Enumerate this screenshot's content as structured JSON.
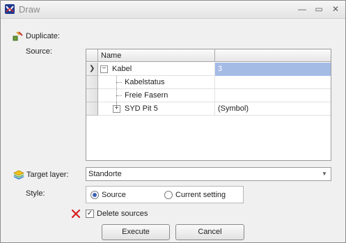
{
  "window": {
    "title": "Draw",
    "minimize": "—",
    "maximize": "▭",
    "close": "✕"
  },
  "duplicate": {
    "label": "Duplicate:"
  },
  "source": {
    "label": "Source:",
    "columns": [
      "Name",
      ""
    ],
    "rows": [
      {
        "name": "Kabel",
        "value": "3",
        "expander": "−"
      },
      {
        "name": "Kabelstatus",
        "value": ""
      },
      {
        "name": "Freie Fasern",
        "value": ""
      },
      {
        "name": "SYD Pit 5",
        "value": "(Symbol)",
        "expander": "+"
      }
    ],
    "current_row_marker": "❯"
  },
  "target_layer": {
    "label": "Target layer:",
    "value": "Standorte"
  },
  "style": {
    "label": "Style:",
    "options": [
      "Source",
      "Current setting"
    ],
    "selected": "Source"
  },
  "delete_sources": {
    "label": "Delete sources",
    "checked": true,
    "check_mark": "✓"
  },
  "buttons": {
    "execute": "Execute",
    "cancel": "Cancel"
  },
  "colors": {
    "selection": "#a4bbe6",
    "accent": "#3e63b5",
    "delete_icon": "#d81e1e"
  }
}
